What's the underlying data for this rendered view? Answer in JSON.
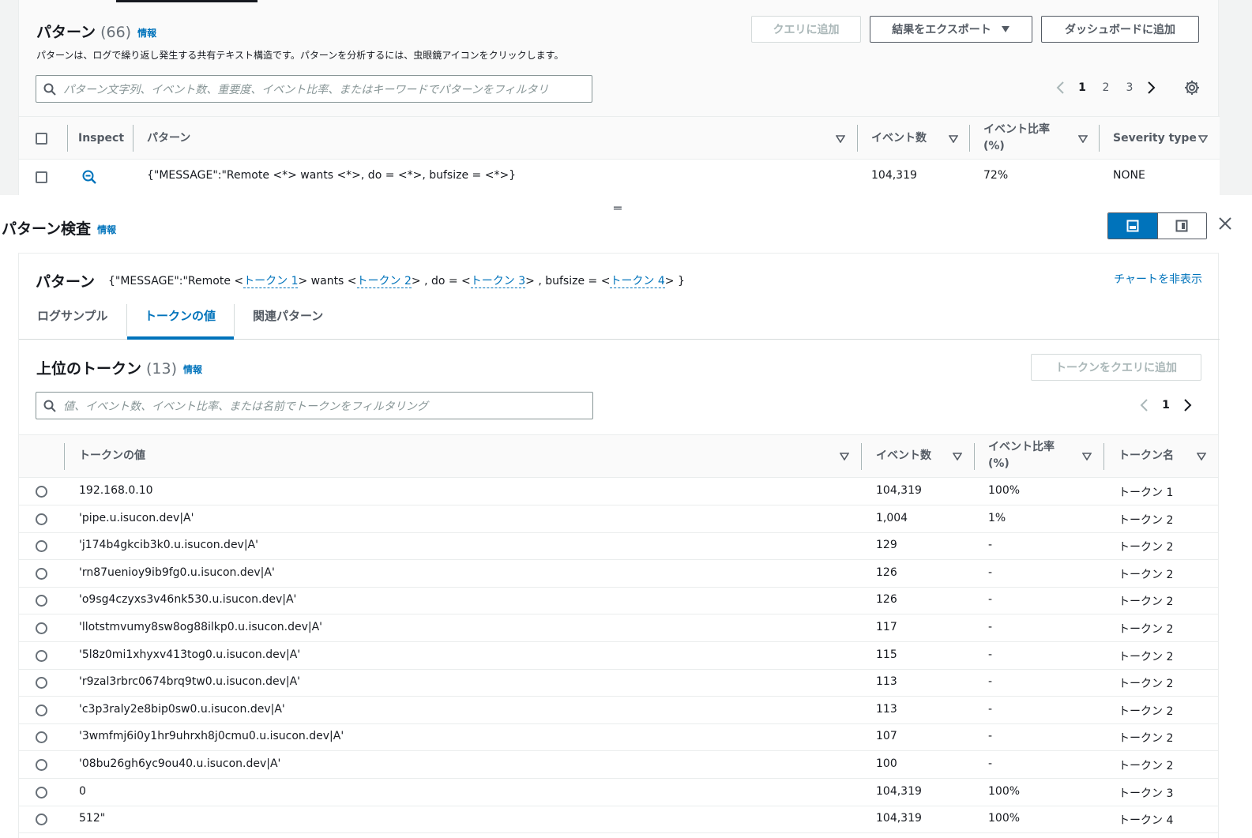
{
  "patterns": {
    "title": "パターン",
    "count": "(66)",
    "info": "情報",
    "description": "パターンは、ログで繰り返し発生する共有テキスト構造です。パターンを分析するには、虫眼鏡アイコンをクリックします。",
    "add_query_label": "クエリに追加",
    "export_label": "結果をエクスポート",
    "dashboard_label": "ダッシュボードに追加",
    "search_placeholder": "パターン文字列、イベント数、重要度、イベント比率、またはキーワードでパターンをフィルタリ",
    "pages": [
      "1",
      "2",
      "3"
    ],
    "columns": {
      "inspect": "Inspect",
      "pattern": "パターン",
      "events": "イベント数",
      "ratio_line1": "イベント比率",
      "ratio_line2": "(%)",
      "severity": "Severity type"
    },
    "row": {
      "pattern": "{\"MESSAGE\":\"Remote <*> wants <*>, do = <*>, bufsize = <*>}",
      "events": "104,319",
      "ratio": "72%",
      "severity": "NONE"
    }
  },
  "inspect": {
    "title": "パターン検査",
    "info": "情報",
    "pattern_label": "パターン",
    "pattern_parts": {
      "p1": "{\"MESSAGE\":\"Remote <",
      "t1": "トークン 1",
      "p2": "> wants <",
      "t2": "トークン 2",
      "p3": "> , do = <",
      "t3": "トークン 3",
      "p4": "> , bufsize = <",
      "t4": "トークン 4",
      "p5": "> }"
    },
    "hide_chart": "チャートを非表示",
    "tabs": [
      "ログサンプル",
      "トークンの値",
      "関連パターン"
    ]
  },
  "tokens": {
    "title": "上位のトークン",
    "count": "(13)",
    "info": "情報",
    "add_to_query": "トークンをクエリに追加",
    "search_placeholder": "値、イベント数、イベント比率、または名前でトークンをフィルタリング",
    "page": "1",
    "columns": {
      "value": "トークンの値",
      "events": "イベント数",
      "ratio_line1": "イベント比率",
      "ratio_line2": "(%)",
      "name": "トークン名"
    },
    "rows": [
      {
        "value": "192.168.0.10",
        "events": "104,319",
        "ratio": "100%",
        "name": "トークン 1"
      },
      {
        "value": "'pipe.u.isucon.dev|A'",
        "events": "1,004",
        "ratio": "1%",
        "name": "トークン 2"
      },
      {
        "value": "'j174b4gkcib3k0.u.isucon.dev|A'",
        "events": "129",
        "ratio": "-",
        "name": "トークン 2"
      },
      {
        "value": "'rn87uenioy9ib9fg0.u.isucon.dev|A'",
        "events": "126",
        "ratio": "-",
        "name": "トークン 2"
      },
      {
        "value": "'o9sg4czyxs3v46nk530.u.isucon.dev|A'",
        "events": "126",
        "ratio": "-",
        "name": "トークン 2"
      },
      {
        "value": "'llotstmvumy8sw8og88ilkp0.u.isucon.dev|A'",
        "events": "117",
        "ratio": "-",
        "name": "トークン 2"
      },
      {
        "value": "'5l8z0mi1xhyxv413tog0.u.isucon.dev|A'",
        "events": "115",
        "ratio": "-",
        "name": "トークン 2"
      },
      {
        "value": "'r9zal3rbrc0674brq9tw0.u.isucon.dev|A'",
        "events": "113",
        "ratio": "-",
        "name": "トークン 2"
      },
      {
        "value": "'c3p3raly2e8bip0sw0.u.isucon.dev|A'",
        "events": "113",
        "ratio": "-",
        "name": "トークン 2"
      },
      {
        "value": "'3wmfmj6i0y1hr9uhrxh8j0cmu0.u.isucon.dev|A'",
        "events": "107",
        "ratio": "-",
        "name": "トークン 2"
      },
      {
        "value": "'08bu26gh6yc9ou40.u.isucon.dev|A'",
        "events": "100",
        "ratio": "-",
        "name": "トークン 2"
      },
      {
        "value": "0",
        "events": "104,319",
        "ratio": "100%",
        "name": "トークン 3"
      },
      {
        "value": "512\"",
        "events": "104,319",
        "ratio": "100%",
        "name": "トークン 4"
      }
    ]
  },
  "colors": {
    "accent": "#0073bb",
    "text": "#16191f",
    "muted": "#545b64"
  }
}
